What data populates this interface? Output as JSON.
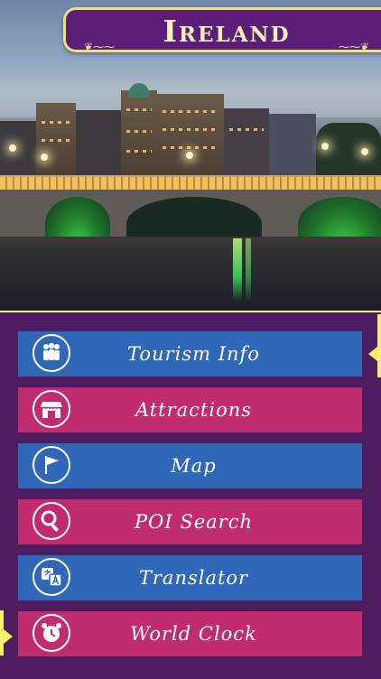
{
  "header": {
    "title": "Ireland",
    "accent_color": "#f1df84",
    "banner_color": "#5b1f7a"
  },
  "hero_image": {
    "description_icon": "dublin-bridge-photo"
  },
  "menu": {
    "items": [
      {
        "label": "Tourism Info",
        "icon": "people-icon",
        "color": "#2f67b9"
      },
      {
        "label": "Attractions",
        "icon": "storefront-icon",
        "color": "#c12c6e"
      },
      {
        "label": "Map",
        "icon": "flag-icon",
        "color": "#2f67b9"
      },
      {
        "label": "POI Search",
        "icon": "magnifier-icon",
        "color": "#c12c6e"
      },
      {
        "label": "Translator",
        "icon": "translate-icon",
        "color": "#2f67b9"
      },
      {
        "label": "World Clock",
        "icon": "alarm-clock-icon",
        "color": "#c12c6e"
      }
    ]
  },
  "panel": {
    "background": "#4d1d5f",
    "edge_color": "#f7ef6b"
  }
}
